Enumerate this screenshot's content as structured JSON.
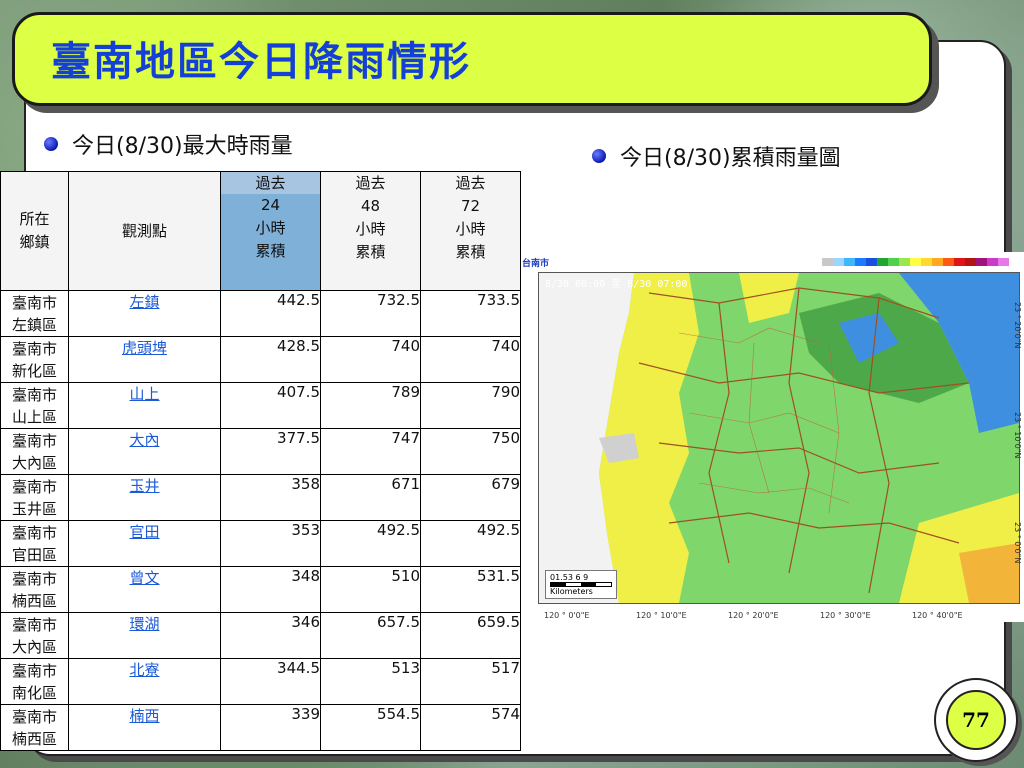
{
  "title": "臺南地區今日降雨情形",
  "left_heading": "今日(8/30)最大時雨量",
  "right_heading": "今日(8/30)累積雨量圖",
  "table": {
    "headers": {
      "area": "所在鄉鎮",
      "station": "觀測點",
      "h24": [
        "過去",
        "24",
        "小時",
        "累積"
      ],
      "h48": [
        "過去",
        "48",
        "小時",
        "累積"
      ],
      "h72": [
        "過去",
        "72",
        "小時",
        "累積"
      ]
    },
    "rows": [
      {
        "area": [
          "臺南市",
          "左鎮區"
        ],
        "station": "左鎮",
        "h24": "442.5",
        "h48": "732.5",
        "h72": "733.5"
      },
      {
        "area": [
          "臺南市",
          "新化區"
        ],
        "station": "虎頭埤",
        "h24": "428.5",
        "h48": "740",
        "h72": "740"
      },
      {
        "area": [
          "臺南市",
          "山上區"
        ],
        "station": "山上",
        "h24": "407.5",
        "h48": "789",
        "h72": "790"
      },
      {
        "area": [
          "臺南市",
          "大內區"
        ],
        "station": "大內",
        "h24": "377.5",
        "h48": "747",
        "h72": "750"
      },
      {
        "area": [
          "臺南市",
          "玉井區"
        ],
        "station": "玉井",
        "h24": "358",
        "h48": "671",
        "h72": "679"
      },
      {
        "area": [
          "臺南市",
          "官田區"
        ],
        "station": "官田",
        "h24": "353",
        "h48": "492.5",
        "h72": "492.5"
      },
      {
        "area": [
          "臺南市",
          "楠西區"
        ],
        "station": "曾文",
        "h24": "348",
        "h48": "510",
        "h72": "531.5"
      },
      {
        "area": [
          "臺南市",
          "大內區"
        ],
        "station": "環湖",
        "h24": "346",
        "h48": "657.5",
        "h72": "659.5"
      },
      {
        "area": [
          "臺南市",
          "南化區"
        ],
        "station": "北寮",
        "h24": "344.5",
        "h48": "513",
        "h72": "517"
      },
      {
        "area": [
          "臺南市",
          "楠西區"
        ],
        "station": "楠西",
        "h24": "339",
        "h48": "554.5",
        "h72": "574"
      }
    ]
  },
  "map": {
    "header_label": "台南市",
    "time_label": "8/30 00:00 至 8/30 07:00",
    "scale_ticks": "01.53   6    9",
    "scale_unit": "Kilometers",
    "x_ticks": [
      "120 ° 0'0\"E",
      "120 ° 10'0\"E",
      "120 ° 20'0\"E",
      "120 ° 30'0\"E",
      "120 ° 40'0\"E"
    ],
    "y_ticks": [
      "23 ° 20'0\"N",
      "23 ° 10'0\"N",
      "23 ° 0'0\"N"
    ],
    "legend_colors": [
      "#c8c8c8",
      "#9bd6ff",
      "#3fb7ff",
      "#1e7bff",
      "#1a4fe0",
      "#1ea832",
      "#4fd24a",
      "#9be650",
      "#ffff40",
      "#ffd830",
      "#ffa820",
      "#ff5a14",
      "#e01414",
      "#b41414",
      "#a0147a",
      "#c83cc8",
      "#e878e8"
    ]
  },
  "page_number": "77"
}
